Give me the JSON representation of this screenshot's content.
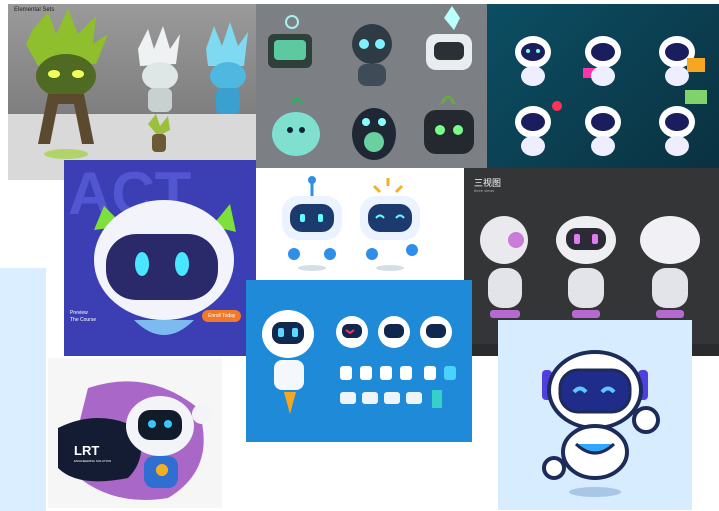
{
  "tile1": {
    "caption": "Elemental Sets"
  },
  "tile4": {
    "backdrop_text": "ACT",
    "preview": [
      "Preview",
      "The Course"
    ],
    "button": "Enroll Today"
  },
  "tile6": {
    "title": "三视图",
    "subtitle": "three views"
  },
  "tile8": {
    "logo": "LRT",
    "logo_sub": "ENGINEERING SOLUTION"
  },
  "colors": {
    "blue_tile": "#1f8ad8",
    "indigo_tile": "#3b3fb3",
    "teal_tile": "#0c4e63",
    "dark_tile": "#333536",
    "light_tile": "#d8ecff",
    "accent_orange": "#f07a2a"
  }
}
